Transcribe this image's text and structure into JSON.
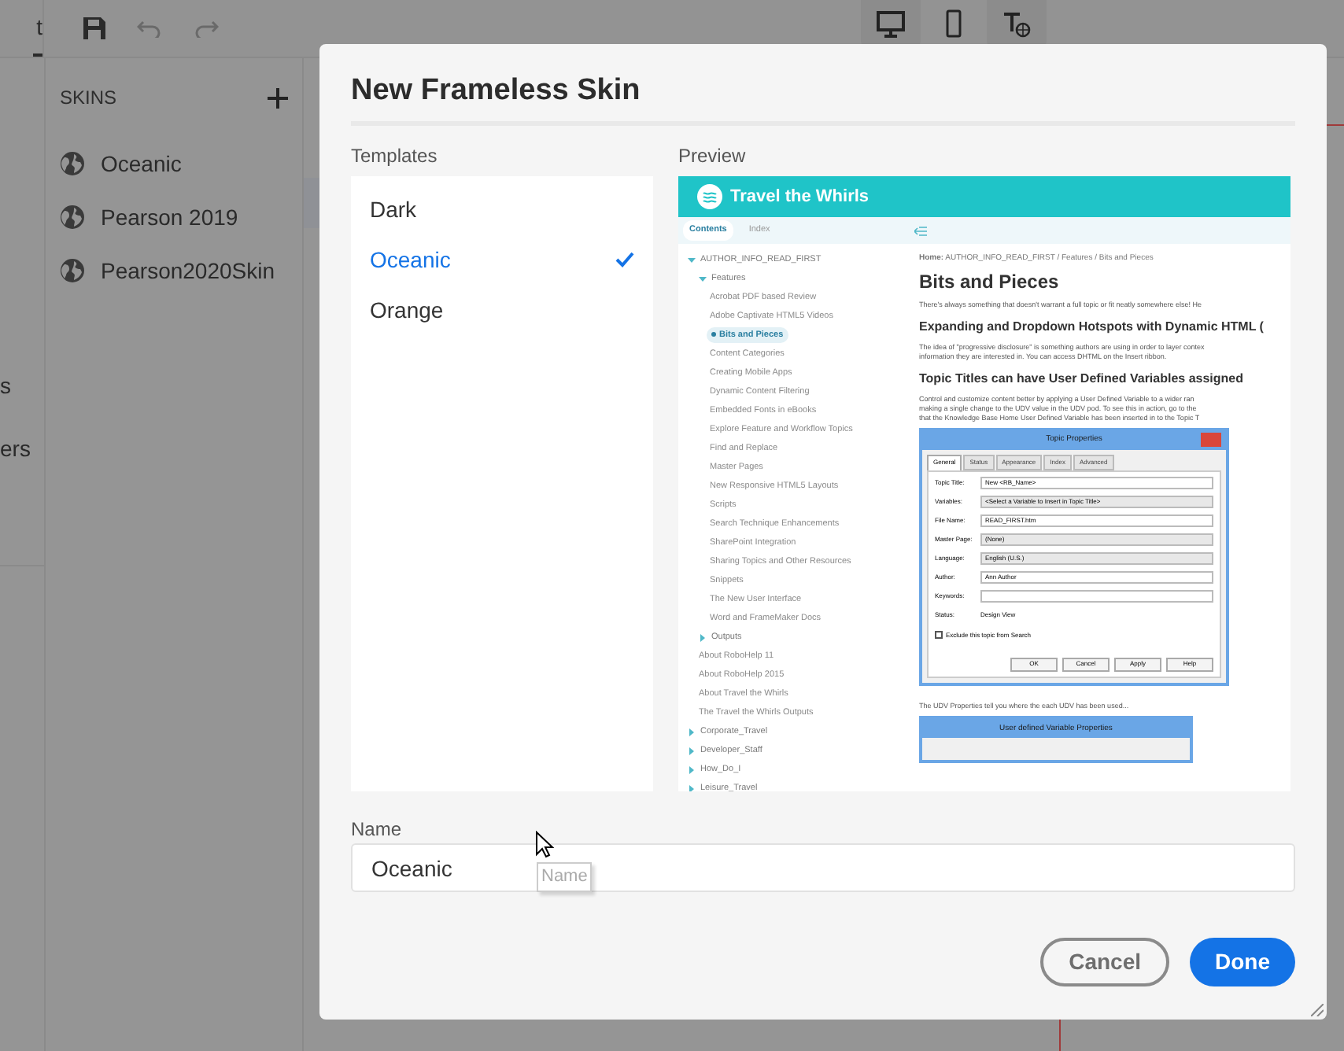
{
  "app": {
    "tab_fragment": "t",
    "side_fragments": [
      "s",
      "ers"
    ],
    "skins_title": "SKINS",
    "skins": [
      {
        "name": "Oceanic"
      },
      {
        "name": "Pearson 2019"
      },
      {
        "name": "Pearson2020Skin"
      }
    ]
  },
  "dialog": {
    "title": "New Frameless Skin",
    "templates_label": "Templates",
    "templates": [
      {
        "name": "Dark",
        "selected": false
      },
      {
        "name": "Oceanic",
        "selected": true
      },
      {
        "name": "Orange",
        "selected": false
      }
    ],
    "preview_label": "Preview",
    "preview": {
      "site_title": "Travel the Whirls",
      "tabs": [
        {
          "label": "Contents",
          "selected": true
        },
        {
          "label": "Index",
          "selected": false
        }
      ],
      "toc": [
        {
          "label": "AUTHOR_INFO_READ_FIRST",
          "expanded": true,
          "children": [
            {
              "label": "Features",
              "expanded": true,
              "children": [
                {
                  "label": "Acrobat PDF based Review",
                  "selected": false
                },
                {
                  "label": "Adobe Captivate HTML5 Videos",
                  "selected": false
                },
                {
                  "label": "Bits and Pieces",
                  "selected": true
                },
                {
                  "label": "Content Categories",
                  "selected": false
                },
                {
                  "label": "Creating Mobile Apps",
                  "selected": false
                },
                {
                  "label": "Dynamic Content Filtering",
                  "selected": false
                },
                {
                  "label": "Embedded Fonts in eBooks",
                  "selected": false
                },
                {
                  "label": "Explore Feature and Workflow Topics",
                  "selected": false
                },
                {
                  "label": "Find and Replace",
                  "selected": false
                },
                {
                  "label": "Master Pages",
                  "selected": false
                },
                {
                  "label": "New Responsive HTML5 Layouts",
                  "selected": false
                },
                {
                  "label": "Scripts",
                  "selected": false
                },
                {
                  "label": "Search Technique Enhancements",
                  "selected": false
                },
                {
                  "label": "SharePoint Integration",
                  "selected": false
                },
                {
                  "label": "Sharing Topics and Other Resources",
                  "selected": false
                },
                {
                  "label": "Snippets",
                  "selected": false
                },
                {
                  "label": "The New User Interface",
                  "selected": false
                },
                {
                  "label": "Word and FrameMaker Docs",
                  "selected": false
                }
              ]
            },
            {
              "label": "Outputs",
              "expanded": false
            },
            {
              "label": "About RoboHelp 11",
              "selected": false
            },
            {
              "label": "About RoboHelp 2015",
              "selected": false
            },
            {
              "label": "About Travel the Whirls",
              "selected": false
            },
            {
              "label": "The Travel the Whirls Outputs",
              "selected": false
            }
          ]
        },
        {
          "label": "Corporate_Travel",
          "expanded": false
        },
        {
          "label": "Developer_Staff",
          "expanded": false
        },
        {
          "label": "How_Do_I",
          "expanded": false
        },
        {
          "label": "Leisure_Travel",
          "expanded": false
        }
      ],
      "breadcrumb": "**Home:** AUTHOR_INFO_READ_FIRST  /  Features  /  Bits and Pieces",
      "heading": "Bits and Pieces",
      "blocks": [
        {
          "kind": "para",
          "lines": [
            "There's always something that doesn't warrant a full topic or fit neatly somewhere else! He"
          ]
        },
        {
          "kind": "subheading",
          "text": "Expanding and Dropdown Hotspots with Dynamic HTML ("
        },
        {
          "kind": "para",
          "lines": [
            "The idea of \"progressive disclosure\" is something authors are using in order to layer contex",
            "information they are interested in. You can access DHTML on the Insert ribbon."
          ]
        },
        {
          "kind": "subheading",
          "text": "Topic Titles can have User Defined Variables assigned"
        },
        {
          "kind": "para",
          "lines": [
            "Control and customize content better by applying a User Defined Variable to a wider ran",
            "making a single change to the UDV value in the UDV pod. To see this in action, go to the",
            "that the Knowledge Base Home User Defined Variable has been inserted in to the Topic T"
          ]
        }
      ],
      "topic_dialog": {
        "title": "Topic Properties",
        "tabs": [
          {
            "label": "General",
            "selected": true
          },
          {
            "label": "Status",
            "selected": false
          },
          {
            "label": "Appearance",
            "selected": false
          },
          {
            "label": "Index",
            "selected": false
          },
          {
            "label": "Advanced",
            "selected": false
          }
        ],
        "fields": [
          {
            "label": "Topic Title:",
            "value": "New <RB_Name>",
            "kind": "text"
          },
          {
            "label": "Variables:",
            "value": "<Select a Variable to Insert in Topic Title>",
            "kind": "select"
          },
          {
            "label": "File Name:",
            "value": "READ_FIRST.htm",
            "kind": "text"
          },
          {
            "label": "Master Page:",
            "value": "(None)",
            "kind": "select"
          },
          {
            "label": "Language:",
            "value": "English (U.S.)",
            "kind": "select"
          },
          {
            "label": "Author:",
            "value": "Ann Author",
            "kind": "text"
          },
          {
            "label": "Keywords:",
            "kind": "text"
          },
          {
            "label": "Status:",
            "value": "Design View",
            "kind": "plain"
          }
        ],
        "checkbox": {
          "label": "Exclude this topic from Search",
          "checked": false
        },
        "buttons": [
          "OK",
          "Cancel",
          "Apply",
          "Help"
        ]
      },
      "after_text": "The UDV Properties tell you where the each UDV has been used...",
      "second_dialog_title": "User defined Variable Properties"
    },
    "name_label": "Name",
    "name_value": "Oceanic",
    "tooltip": "Name",
    "buttons": [
      {
        "label": "Cancel",
        "kind": "secondary"
      },
      {
        "label": "Done",
        "kind": "primary"
      }
    ]
  }
}
